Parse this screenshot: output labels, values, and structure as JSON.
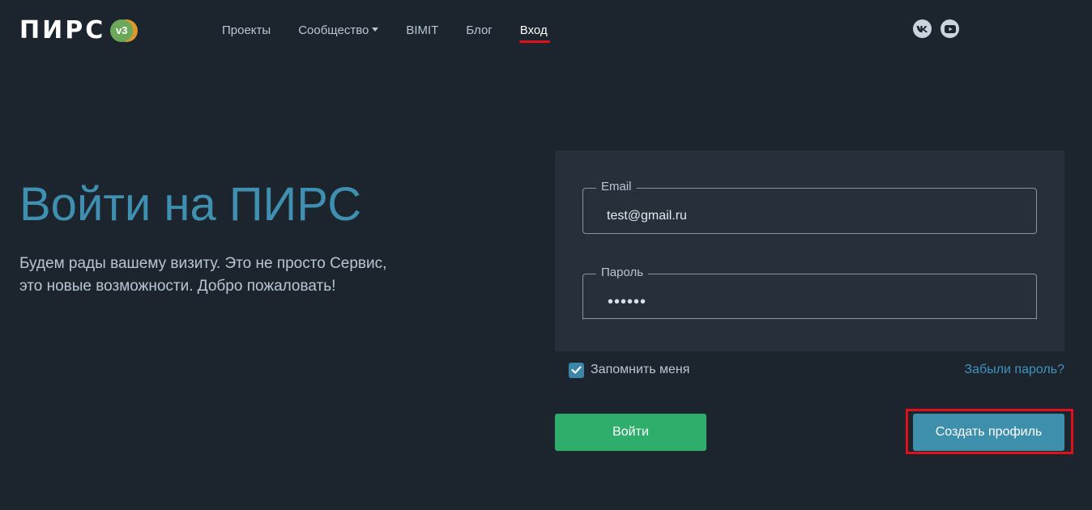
{
  "header": {
    "logo_text": "ПИРС",
    "logo_badge": "v3",
    "nav": [
      {
        "label": "Проекты",
        "has_dropdown": false,
        "active": false
      },
      {
        "label": "Сообщество",
        "has_dropdown": true,
        "active": false
      },
      {
        "label": "BIMIT",
        "has_dropdown": false,
        "active": false
      },
      {
        "label": "Блог",
        "has_dropdown": false,
        "active": false
      },
      {
        "label": "Вход",
        "has_dropdown": false,
        "active": true
      }
    ],
    "social": [
      {
        "icon": "vk-icon"
      },
      {
        "icon": "youtube-icon"
      }
    ]
  },
  "hero": {
    "title": "Войти на ПИРС",
    "subtitle": "Будем рады вашему визиту. Это не просто Сервис, это новые возможности. Добро пожаловать!"
  },
  "form": {
    "email_label": "Email",
    "email_value": "test@gmail.ru",
    "password_label": "Пароль",
    "password_value": "••••••",
    "remember_label": "Запомнить меня",
    "remember_checked": true,
    "forgot_label": "Забыли пароль?",
    "login_button": "Войти",
    "register_button": "Создать профиль"
  },
  "colors": {
    "background": "#1c252e",
    "card": "#25303b",
    "accent_title": "#3f8fb0",
    "login_green": "#2fae6b",
    "register_blue": "#3e8fab",
    "highlight_red": "#e0101a"
  }
}
